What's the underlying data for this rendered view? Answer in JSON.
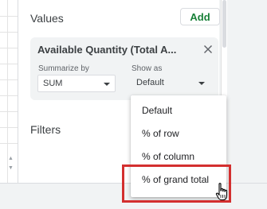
{
  "values_section": {
    "title": "Values",
    "add_label": "Add"
  },
  "value_card": {
    "title": "Available Quantity (Total A...",
    "summarize": {
      "label": "Summarize by",
      "value": "SUM"
    },
    "show_as": {
      "label": "Show as",
      "value": "Default"
    }
  },
  "filters_section": {
    "title": "Filters"
  },
  "show_as_menu": {
    "items": [
      {
        "label": "Default"
      },
      {
        "label": "% of row"
      },
      {
        "label": "% of column"
      },
      {
        "label": "% of grand total"
      }
    ],
    "highlighted_index": 3
  },
  "colors": {
    "accent_green": "#188038",
    "highlight_red": "#d32f2f"
  }
}
